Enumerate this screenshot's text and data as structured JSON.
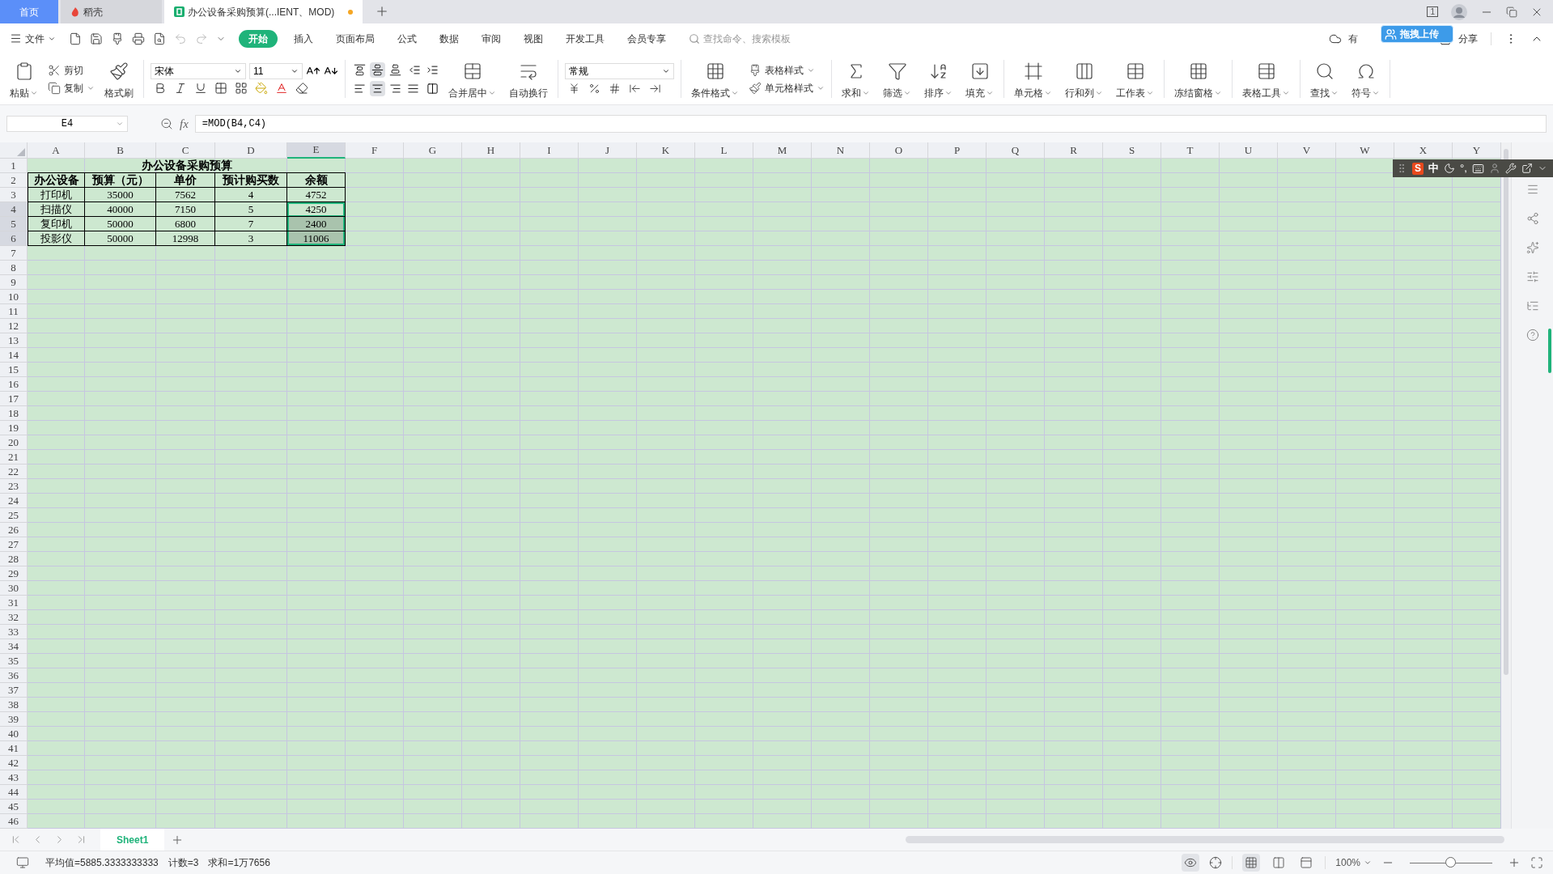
{
  "tabs": [
    {
      "label": "首页",
      "kind": "home",
      "selected": false
    },
    {
      "label": "稻壳",
      "kind": "docer",
      "selected": false
    },
    {
      "label": "办公设备采购预算(...IENT、MOD)",
      "kind": "sheet",
      "selected": true,
      "modified": true
    }
  ],
  "title_bar": {
    "window_count": "1"
  },
  "menu": {
    "file": "文件",
    "tabs": [
      {
        "label": "开始",
        "selected": true
      },
      {
        "label": "插入",
        "selected": false
      },
      {
        "label": "页面布局",
        "selected": false
      },
      {
        "label": "公式",
        "selected": false
      },
      {
        "label": "数据",
        "selected": false
      },
      {
        "label": "审阅",
        "selected": false
      },
      {
        "label": "视图",
        "selected": false
      },
      {
        "label": "开发工具",
        "selected": false
      },
      {
        "label": "会员专享",
        "selected": false
      }
    ],
    "search": {
      "placeholder": "查找命令、搜索模板"
    },
    "cloud": "有",
    "upload": "拖拽上传",
    "share": "分享"
  },
  "ribbon": {
    "paste": "粘贴",
    "cut": "剪切",
    "copy": "复制",
    "painter": "格式刷",
    "font_name": "宋体",
    "font_size": "11",
    "vertical_align": [
      {
        "kind": "top",
        "selected": false
      },
      {
        "kind": "middle",
        "selected": true
      },
      {
        "kind": "bottom",
        "selected": false
      }
    ],
    "horizontal_align": [
      {
        "kind": "left",
        "selected": false
      },
      {
        "kind": "center",
        "selected": true
      },
      {
        "kind": "right",
        "selected": false
      },
      {
        "kind": "justify",
        "selected": false
      }
    ],
    "merge": "合并居中",
    "wrap": "自动换行",
    "number_format": "常规",
    "conditional": "条件格式",
    "table_style": "表格样式",
    "cell_style": "单元格样式",
    "tools": [
      {
        "label": "求和",
        "kind": "sum"
      },
      {
        "label": "筛选",
        "kind": "filter"
      },
      {
        "label": "排序",
        "kind": "sort"
      },
      {
        "label": "填充",
        "kind": "fill"
      },
      {
        "label": "单元格",
        "kind": "cell"
      },
      {
        "label": "行和列",
        "kind": "rowcol"
      },
      {
        "label": "工作表",
        "kind": "sheet"
      },
      {
        "label": "冻结窗格",
        "kind": "freeze"
      },
      {
        "label": "表格工具",
        "kind": "tabletools"
      },
      {
        "label": "查找",
        "kind": "find"
      },
      {
        "label": "符号",
        "kind": "symbol"
      }
    ]
  },
  "name_box": "E4",
  "function_label": "fx",
  "formula": "=MOD(B4,C4)",
  "columns": [
    {
      "label": "A",
      "selected": false
    },
    {
      "label": "B",
      "selected": false
    },
    {
      "label": "C",
      "selected": false
    },
    {
      "label": "D",
      "selected": false
    },
    {
      "label": "E",
      "selected": true
    },
    {
      "label": "F",
      "selected": false
    },
    {
      "label": "G",
      "selected": false
    },
    {
      "label": "H",
      "selected": false
    },
    {
      "label": "I",
      "selected": false
    },
    {
      "label": "J",
      "selected": false
    },
    {
      "label": "K",
      "selected": false
    },
    {
      "label": "L",
      "selected": false
    },
    {
      "label": "M",
      "selected": false
    },
    {
      "label": "N",
      "selected": false
    },
    {
      "label": "O",
      "selected": false
    },
    {
      "label": "P",
      "selected": false
    },
    {
      "label": "Q",
      "selected": false
    },
    {
      "label": "R",
      "selected": false
    },
    {
      "label": "S",
      "selected": false
    },
    {
      "label": "T",
      "selected": false
    },
    {
      "label": "U",
      "selected": false
    },
    {
      "label": "V",
      "selected": false
    },
    {
      "label": "W",
      "selected": false
    },
    {
      "label": "X",
      "selected": false
    },
    {
      "label": "Y",
      "selected": false
    }
  ],
  "row_numbers": [
    {
      "label": "1",
      "selected": false
    },
    {
      "label": "2",
      "selected": false
    },
    {
      "label": "3",
      "selected": false
    },
    {
      "label": "4",
      "selected": true
    },
    {
      "label": "5",
      "selected": true
    },
    {
      "label": "6",
      "selected": true
    },
    {
      "label": "7",
      "selected": false
    },
    {
      "label": "8",
      "selected": false
    },
    {
      "label": "9",
      "selected": false
    },
    {
      "label": "10",
      "selected": false
    },
    {
      "label": "11",
      "selected": false
    },
    {
      "label": "12",
      "selected": false
    },
    {
      "label": "13",
      "selected": false
    },
    {
      "label": "14",
      "selected": false
    },
    {
      "label": "15",
      "selected": false
    },
    {
      "label": "16",
      "selected": false
    },
    {
      "label": "17",
      "selected": false
    },
    {
      "label": "18",
      "selected": false
    },
    {
      "label": "19",
      "selected": false
    },
    {
      "label": "20",
      "selected": false
    },
    {
      "label": "21",
      "selected": false
    },
    {
      "label": "22",
      "selected": false
    },
    {
      "label": "23",
      "selected": false
    },
    {
      "label": "24",
      "selected": false
    },
    {
      "label": "25",
      "selected": false
    },
    {
      "label": "26",
      "selected": false
    },
    {
      "label": "27",
      "selected": false
    },
    {
      "label": "28",
      "selected": false
    },
    {
      "label": "29",
      "selected": false
    },
    {
      "label": "30",
      "selected": false
    },
    {
      "label": "31",
      "selected": false
    },
    {
      "label": "32",
      "selected": false
    },
    {
      "label": "33",
      "selected": false
    },
    {
      "label": "34",
      "selected": false
    },
    {
      "label": "35",
      "selected": false
    },
    {
      "label": "36",
      "selected": false
    },
    {
      "label": "37",
      "selected": false
    },
    {
      "label": "38",
      "selected": false
    },
    {
      "label": "39",
      "selected": false
    },
    {
      "label": "40",
      "selected": false
    },
    {
      "label": "41",
      "selected": false
    },
    {
      "label": "42",
      "selected": false
    },
    {
      "label": "43",
      "selected": false
    },
    {
      "label": "44",
      "selected": false
    },
    {
      "label": "45",
      "selected": false
    },
    {
      "label": "46",
      "selected": false
    }
  ],
  "table": {
    "title": "办公设备采购预算",
    "headers": [
      "办公设备",
      "预算（元）",
      "单价",
      "预计购买数",
      "余额"
    ],
    "rows": [
      {
        "cells": [
          "打印机",
          "35000",
          "7562",
          "4",
          "4752"
        ],
        "selected": false,
        "active": false
      },
      {
        "cells": [
          "扫描仪",
          "40000",
          "7150",
          "5",
          "4250"
        ],
        "selected": true,
        "active": true
      },
      {
        "cells": [
          "复印机",
          "50000",
          "6800",
          "7",
          "2400"
        ],
        "selected": true,
        "active": false
      },
      {
        "cells": [
          "投影仪",
          "50000",
          "12998",
          "3",
          "11006"
        ],
        "selected": true,
        "active": false
      }
    ]
  },
  "ime_bar": {
    "logo": "S",
    "mode": "中",
    "punct": "°,"
  },
  "sheets": [
    {
      "label": "Sheet1",
      "selected": true
    }
  ],
  "status": {
    "average": "平均值=5885.3333333333",
    "count": "计数=3",
    "sum": "求和=1万7656",
    "zoom": "100%",
    "zoom_slider": {
      "level": 0.5
    },
    "views": [
      {
        "kind": "normal",
        "selected": true
      },
      {
        "kind": "page_break",
        "selected": false
      },
      {
        "kind": "page_layout",
        "selected": false
      }
    ]
  }
}
